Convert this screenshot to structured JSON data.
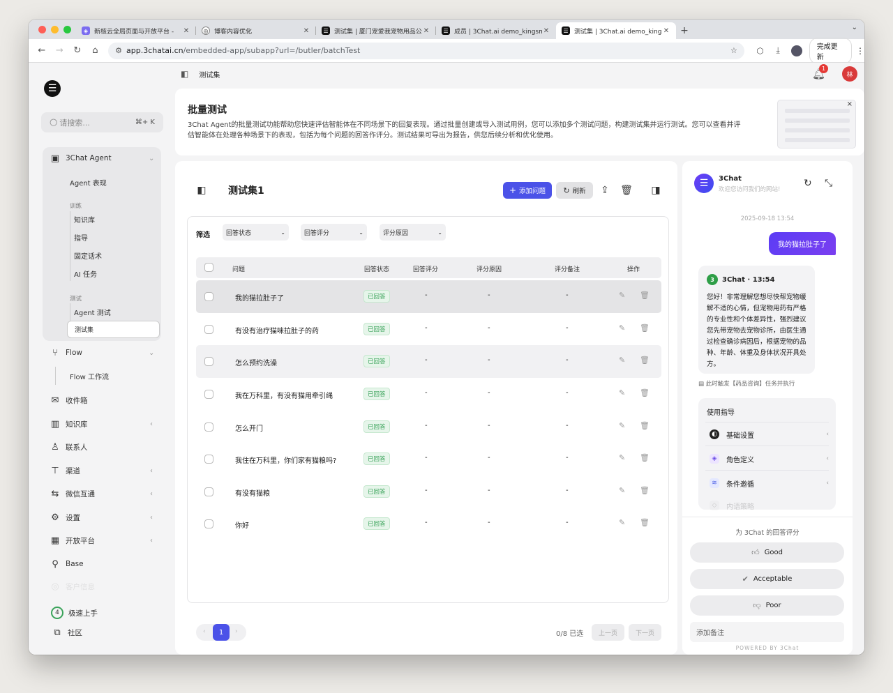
{
  "browser": {
    "tabs": [
      {
        "title": "新核云全局页面与开放平台 - "
      },
      {
        "title": "博客内容优化"
      },
      {
        "title": "测试集 | 厦门宠爱我宠物用品公"
      },
      {
        "title": "成员 | 3Chat.ai demo_kingsm"
      },
      {
        "title": "测试集 | 3Chat.ai demo_kings"
      }
    ],
    "url_host": "app.3chatai.cn",
    "url_path": "/embedded-app/subapp?url=/butler/batchTest",
    "update_label": "完成更新"
  },
  "sidebar": {
    "search_placeholder": "请搜索...",
    "search_shortcut": "⌘+ K",
    "group_title": "3Chat Agent",
    "agent_perf": "Agent 表现",
    "train_label": "训练",
    "train_items": [
      "知识库",
      "指导",
      "固定话术",
      "AI 任务"
    ],
    "test_label": "测试",
    "test_items": [
      "Agent 测试",
      "测试集"
    ],
    "flow": "Flow",
    "flow_work": "Flow 工作流",
    "items": [
      "收件箱",
      "知识库",
      "联系人",
      "渠道",
      "微信互通",
      "设置",
      "开放平台",
      "Base",
      "客户信息"
    ],
    "onboard_count": "4",
    "onboard": "极速上手",
    "community": "社区"
  },
  "topbar": {
    "breadcrumb": "测试集",
    "notif_count": "1",
    "avatar": "林"
  },
  "intro": {
    "title": "批量测试",
    "desc": "3Chat Agent的批量测试功能帮助您快速评估智能体在不同场景下的回复表现。通过批量创建或导入测试用例，您可以添加多个测试问题，构建测试集并运行测试。您可以查看并评估智能体在处理各种场景下的表现，包括为每个问题的回答作评分。测试结果可导出为报告，供您后续分析和优化使用。"
  },
  "main": {
    "title": "测试集1",
    "add_label": "添加问题",
    "refresh_label": "刷新",
    "filter_label": "筛选",
    "filters": [
      "回答状态",
      "回答评分",
      "评分原因"
    ],
    "columns": [
      "问题",
      "回答状态",
      "回答评分",
      "评分原因",
      "评分备注",
      "操作"
    ],
    "rows": [
      {
        "q": "我的猫拉肚子了",
        "status": "已回答",
        "score": "-",
        "reason": "-",
        "note": "-"
      },
      {
        "q": "有没有治疗猫咪拉肚子的药",
        "status": "已回答",
        "score": "-",
        "reason": "-",
        "note": "-"
      },
      {
        "q": "怎么预约洗澡",
        "status": "已回答",
        "score": "-",
        "reason": "-",
        "note": "-"
      },
      {
        "q": "我在万科里，有没有猫用牵引绳",
        "status": "已回答",
        "score": "-",
        "reason": "-",
        "note": "-"
      },
      {
        "q": "怎么开门",
        "status": "已回答",
        "score": "-",
        "reason": "-",
        "note": "-"
      },
      {
        "q": "我住在万科里，你们家有猫粮吗?",
        "status": "已回答",
        "score": "-",
        "reason": "-",
        "note": "-"
      },
      {
        "q": "有没有猫粮",
        "status": "已回答",
        "score": "-",
        "reason": "-",
        "note": "-"
      },
      {
        "q": "你好",
        "status": "已回答",
        "score": "-",
        "reason": "-",
        "note": "-"
      }
    ],
    "page": "1",
    "selected": "0/8 已选",
    "prev": "上一页",
    "next": "下一页"
  },
  "chat": {
    "name": "3Chat",
    "welcome": "欢迎您访问我们的网站!",
    "time": "2025-09-18 13:54",
    "user_msg": "我的猫拉肚子了",
    "bot_badge": "3",
    "bot_header": "3Chat · 13:54",
    "bot_msg": "您好！非常理解您想尽快帮宠物缓解不适的心情，但宠物用药有严格的专业性和个体差异性，强烈建议您先带宠物去宠物诊所，由医生通过检查确诊病因后，根据宠物的品种、年龄、体重及身体状况开具处方。",
    "trigger": "此时触发【药品咨询】任务并执行",
    "guide_title": "使用指导",
    "guide_items": [
      "基础设置",
      "角色定义",
      "条件邀循",
      "内语策略"
    ],
    "rate_title": "为 3Chat 的回答评分",
    "rate_good": "Good",
    "rate_ok": "Acceptable",
    "rate_poor": "Poor",
    "note_placeholder": "添加备注",
    "powered": "POWERED BY  3Chat"
  }
}
